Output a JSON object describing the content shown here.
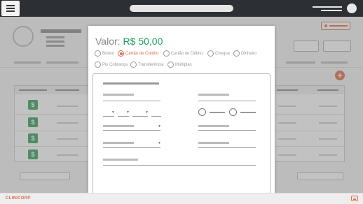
{
  "payment_modal": {
    "valor_label": "Valor:",
    "valor_amount": "R$ 50,00",
    "methods": [
      {
        "label": "Boleto",
        "selected": false
      },
      {
        "label": "Cartão de Crédito",
        "selected": true
      },
      {
        "label": "Cartão de Débito",
        "selected": false
      },
      {
        "label": "Cheque",
        "selected": false
      },
      {
        "label": "Dinheiro",
        "selected": false
      },
      {
        "label": "Pix Cobrança",
        "selected": false
      },
      {
        "label": "Transferência",
        "selected": false
      },
      {
        "label": "Múltiplas",
        "selected": false
      }
    ]
  },
  "table": {
    "row_badge": "$"
  },
  "actions": {
    "add_label": "+"
  },
  "footer": {
    "brand": "CLINICORP"
  },
  "colors": {
    "accent": "#e06b4a",
    "success": "#1aa35b",
    "topbar": "#2c2f33"
  }
}
